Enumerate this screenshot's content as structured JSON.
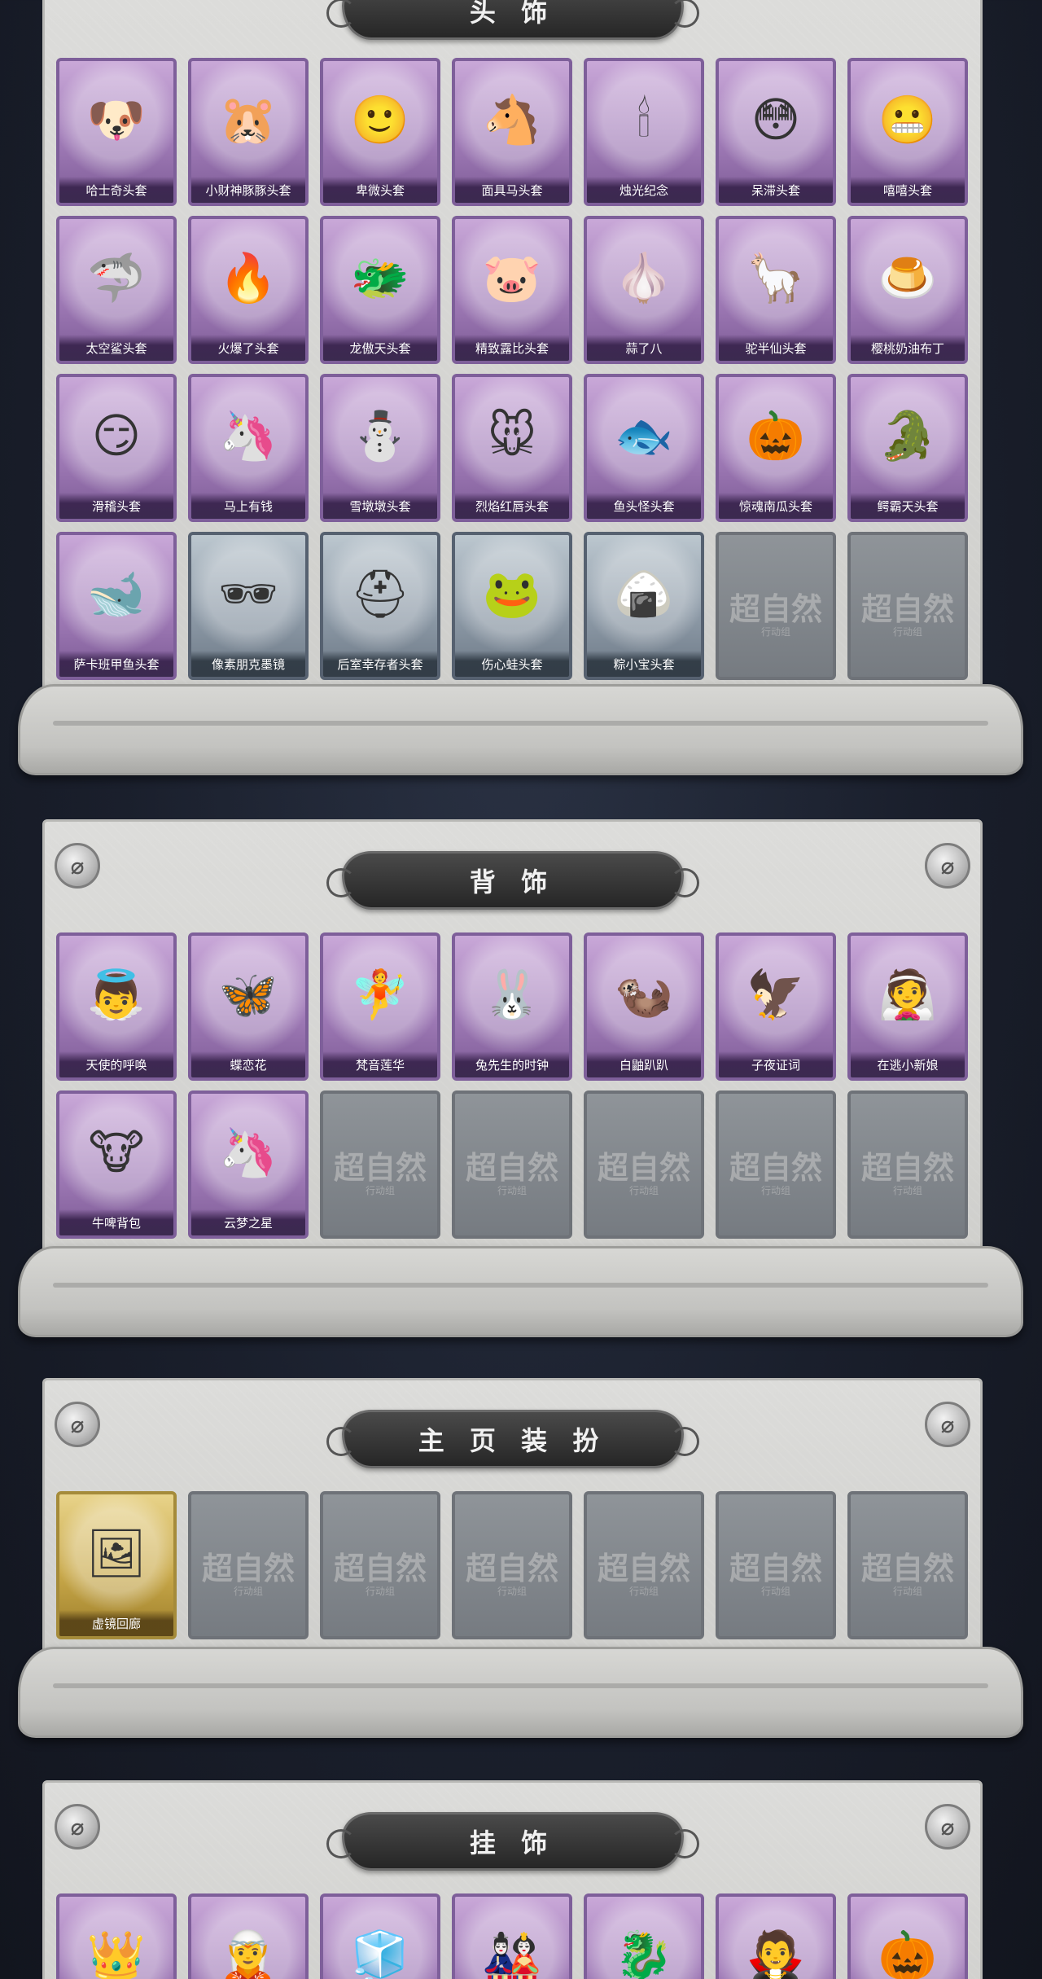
{
  "sections": [
    {
      "id": "headwear",
      "title": "头 饰",
      "items": [
        {
          "label": "哈士奇头套",
          "icon": "🐶",
          "style": "purple"
        },
        {
          "label": "小财神豚豚头套",
          "icon": "🐹",
          "style": "purple"
        },
        {
          "label": "卑微头套",
          "icon": "🙂",
          "style": "purple"
        },
        {
          "label": "面具马头套",
          "icon": "🐴",
          "style": "purple"
        },
        {
          "label": "烛光纪念",
          "icon": "🕯",
          "style": "purple"
        },
        {
          "label": "呆滞头套",
          "icon": "😳",
          "style": "purple"
        },
        {
          "label": "嘻嘻头套",
          "icon": "😬",
          "style": "purple"
        },
        {
          "label": "太空鲨头套",
          "icon": "🦈",
          "style": "purple"
        },
        {
          "label": "火爆了头套",
          "icon": "🔥",
          "style": "purple"
        },
        {
          "label": "龙傲天头套",
          "icon": "🐲",
          "style": "purple"
        },
        {
          "label": "精致露比头套",
          "icon": "🐷",
          "style": "purple"
        },
        {
          "label": "蒜了八",
          "icon": "🧄",
          "style": "purple"
        },
        {
          "label": "驼半仙头套",
          "icon": "🦙",
          "style": "purple"
        },
        {
          "label": "樱桃奶油布丁",
          "icon": "🍮",
          "style": "purple"
        },
        {
          "label": "滑稽头套",
          "icon": "😏",
          "style": "purple"
        },
        {
          "label": "马上有钱",
          "icon": "🦄",
          "style": "purple"
        },
        {
          "label": "雪墩墩头套",
          "icon": "⛄",
          "style": "purple"
        },
        {
          "label": "烈焰红唇头套",
          "icon": "🐭",
          "style": "purple"
        },
        {
          "label": "鱼头怪头套",
          "icon": "🐟",
          "style": "purple"
        },
        {
          "label": "惊魂南瓜头套",
          "icon": "🎃",
          "style": "purple"
        },
        {
          "label": "鳄霸天头套",
          "icon": "🐊",
          "style": "purple"
        },
        {
          "label": "萨卡班甲鱼头套",
          "icon": "🐋",
          "style": "purple"
        },
        {
          "label": "像素朋克墨镜",
          "icon": "🕶",
          "style": "blue"
        },
        {
          "label": "后室幸存者头套",
          "icon": "⛑",
          "style": "blue"
        },
        {
          "label": "伤心蛙头套",
          "icon": "🐸",
          "style": "blue"
        },
        {
          "label": "粽小宝头套",
          "icon": "🍙",
          "style": "blue"
        },
        {
          "label": "",
          "icon": "",
          "style": "placeholder"
        },
        {
          "label": "",
          "icon": "",
          "style": "placeholder"
        }
      ]
    },
    {
      "id": "backwear",
      "title": "背 饰",
      "items": [
        {
          "label": "天使的呼唤",
          "icon": "👼",
          "style": "purple"
        },
        {
          "label": "蝶恋花",
          "icon": "🦋",
          "style": "purple"
        },
        {
          "label": "梵音莲华",
          "icon": "🧚",
          "style": "purple"
        },
        {
          "label": "兔先生的时钟",
          "icon": "🐰",
          "style": "purple"
        },
        {
          "label": "白鼬趴趴",
          "icon": "🦦",
          "style": "purple"
        },
        {
          "label": "子夜证词",
          "icon": "🦅",
          "style": "purple"
        },
        {
          "label": "在逃小新娘",
          "icon": "👰",
          "style": "purple"
        },
        {
          "label": "牛啤背包",
          "icon": "🐮",
          "style": "purple"
        },
        {
          "label": "云梦之星",
          "icon": "🦄",
          "style": "purple"
        },
        {
          "label": "",
          "icon": "",
          "style": "placeholder"
        },
        {
          "label": "",
          "icon": "",
          "style": "placeholder"
        },
        {
          "label": "",
          "icon": "",
          "style": "placeholder"
        },
        {
          "label": "",
          "icon": "",
          "style": "placeholder"
        },
        {
          "label": "",
          "icon": "",
          "style": "placeholder"
        }
      ]
    },
    {
      "id": "homepage",
      "title": "主 页 装 扮",
      "items": [
        {
          "label": "虚镜回廊",
          "icon": "🖼",
          "style": "gold"
        },
        {
          "label": "",
          "icon": "",
          "style": "placeholder"
        },
        {
          "label": "",
          "icon": "",
          "style": "placeholder"
        },
        {
          "label": "",
          "icon": "",
          "style": "placeholder"
        },
        {
          "label": "",
          "icon": "",
          "style": "placeholder"
        },
        {
          "label": "",
          "icon": "",
          "style": "placeholder"
        },
        {
          "label": "",
          "icon": "",
          "style": "placeholder"
        }
      ]
    },
    {
      "id": "pendant",
      "title": "挂 饰",
      "items": [
        {
          "label": "",
          "icon": "👑",
          "style": "purple"
        },
        {
          "label": "",
          "icon": "🧝",
          "style": "purple"
        },
        {
          "label": "",
          "icon": "🧊",
          "style": "purple"
        },
        {
          "label": "",
          "icon": "🎎",
          "style": "purple"
        },
        {
          "label": "",
          "icon": "🐉",
          "style": "purple"
        },
        {
          "label": "",
          "icon": "🧛",
          "style": "purple"
        },
        {
          "label": "",
          "icon": "🎃",
          "style": "purple"
        }
      ]
    }
  ],
  "placeholder": {
    "mark": "超自然",
    "sub": "行动组"
  },
  "colors": {
    "card_purple": "#a17cb8",
    "card_blue": "#8e9ba8",
    "card_gold": "#c9a94a",
    "banner": "#2f2f2f",
    "panel": "#d4d4d1"
  }
}
